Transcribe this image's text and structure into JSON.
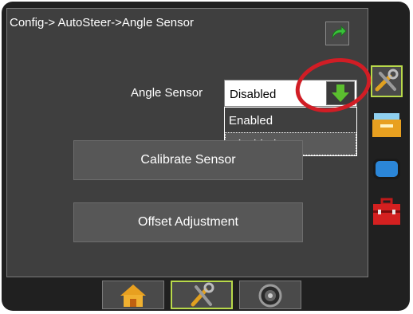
{
  "breadcrumb": "Config-> AutoSteer->Angle Sensor",
  "angle_sensor": {
    "label": "Angle Sensor",
    "selected": "Disabled",
    "options": [
      "Enabled",
      "Disabled"
    ]
  },
  "buttons": {
    "calibrate": "Calibrate Sensor",
    "offset": "Offset Adjustment"
  },
  "icons": {
    "back": "undo-arrow-icon",
    "dropdown_arrow": "arrow-down-icon",
    "side_tabs": [
      "tools-icon",
      "data-files-icon",
      "console-icon",
      "toolbox-icon"
    ],
    "bottom_nav": [
      "home-icon",
      "tools-icon",
      "gauge-icon"
    ]
  },
  "colors": {
    "accent_green": "#b8d94a",
    "highlight_red": "#d11d25",
    "arrow_green": "#4caf2e"
  }
}
